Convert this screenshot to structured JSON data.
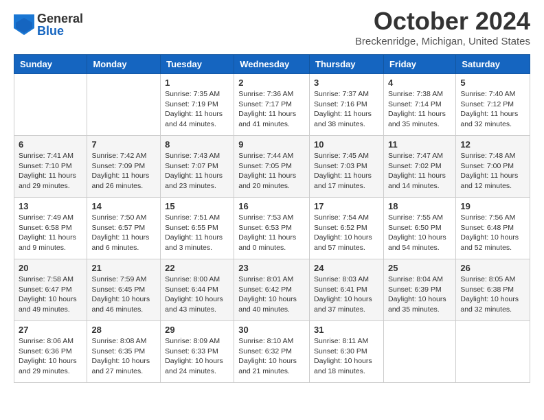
{
  "header": {
    "logo_general": "General",
    "logo_blue": "Blue",
    "title": "October 2024",
    "subtitle": "Breckenridge, Michigan, United States"
  },
  "days_of_week": [
    "Sunday",
    "Monday",
    "Tuesday",
    "Wednesday",
    "Thursday",
    "Friday",
    "Saturday"
  ],
  "weeks": [
    [
      {
        "day": null,
        "info": null
      },
      {
        "day": null,
        "info": null
      },
      {
        "day": "1",
        "info": "Sunrise: 7:35 AM\nSunset: 7:19 PM\nDaylight: 11 hours and 44 minutes."
      },
      {
        "day": "2",
        "info": "Sunrise: 7:36 AM\nSunset: 7:17 PM\nDaylight: 11 hours and 41 minutes."
      },
      {
        "day": "3",
        "info": "Sunrise: 7:37 AM\nSunset: 7:16 PM\nDaylight: 11 hours and 38 minutes."
      },
      {
        "day": "4",
        "info": "Sunrise: 7:38 AM\nSunset: 7:14 PM\nDaylight: 11 hours and 35 minutes."
      },
      {
        "day": "5",
        "info": "Sunrise: 7:40 AM\nSunset: 7:12 PM\nDaylight: 11 hours and 32 minutes."
      }
    ],
    [
      {
        "day": "6",
        "info": "Sunrise: 7:41 AM\nSunset: 7:10 PM\nDaylight: 11 hours and 29 minutes."
      },
      {
        "day": "7",
        "info": "Sunrise: 7:42 AM\nSunset: 7:09 PM\nDaylight: 11 hours and 26 minutes."
      },
      {
        "day": "8",
        "info": "Sunrise: 7:43 AM\nSunset: 7:07 PM\nDaylight: 11 hours and 23 minutes."
      },
      {
        "day": "9",
        "info": "Sunrise: 7:44 AM\nSunset: 7:05 PM\nDaylight: 11 hours and 20 minutes."
      },
      {
        "day": "10",
        "info": "Sunrise: 7:45 AM\nSunset: 7:03 PM\nDaylight: 11 hours and 17 minutes."
      },
      {
        "day": "11",
        "info": "Sunrise: 7:47 AM\nSunset: 7:02 PM\nDaylight: 11 hours and 14 minutes."
      },
      {
        "day": "12",
        "info": "Sunrise: 7:48 AM\nSunset: 7:00 PM\nDaylight: 11 hours and 12 minutes."
      }
    ],
    [
      {
        "day": "13",
        "info": "Sunrise: 7:49 AM\nSunset: 6:58 PM\nDaylight: 11 hours and 9 minutes."
      },
      {
        "day": "14",
        "info": "Sunrise: 7:50 AM\nSunset: 6:57 PM\nDaylight: 11 hours and 6 minutes."
      },
      {
        "day": "15",
        "info": "Sunrise: 7:51 AM\nSunset: 6:55 PM\nDaylight: 11 hours and 3 minutes."
      },
      {
        "day": "16",
        "info": "Sunrise: 7:53 AM\nSunset: 6:53 PM\nDaylight: 11 hours and 0 minutes."
      },
      {
        "day": "17",
        "info": "Sunrise: 7:54 AM\nSunset: 6:52 PM\nDaylight: 10 hours and 57 minutes."
      },
      {
        "day": "18",
        "info": "Sunrise: 7:55 AM\nSunset: 6:50 PM\nDaylight: 10 hours and 54 minutes."
      },
      {
        "day": "19",
        "info": "Sunrise: 7:56 AM\nSunset: 6:48 PM\nDaylight: 10 hours and 52 minutes."
      }
    ],
    [
      {
        "day": "20",
        "info": "Sunrise: 7:58 AM\nSunset: 6:47 PM\nDaylight: 10 hours and 49 minutes."
      },
      {
        "day": "21",
        "info": "Sunrise: 7:59 AM\nSunset: 6:45 PM\nDaylight: 10 hours and 46 minutes."
      },
      {
        "day": "22",
        "info": "Sunrise: 8:00 AM\nSunset: 6:44 PM\nDaylight: 10 hours and 43 minutes."
      },
      {
        "day": "23",
        "info": "Sunrise: 8:01 AM\nSunset: 6:42 PM\nDaylight: 10 hours and 40 minutes."
      },
      {
        "day": "24",
        "info": "Sunrise: 8:03 AM\nSunset: 6:41 PM\nDaylight: 10 hours and 37 minutes."
      },
      {
        "day": "25",
        "info": "Sunrise: 8:04 AM\nSunset: 6:39 PM\nDaylight: 10 hours and 35 minutes."
      },
      {
        "day": "26",
        "info": "Sunrise: 8:05 AM\nSunset: 6:38 PM\nDaylight: 10 hours and 32 minutes."
      }
    ],
    [
      {
        "day": "27",
        "info": "Sunrise: 8:06 AM\nSunset: 6:36 PM\nDaylight: 10 hours and 29 minutes."
      },
      {
        "day": "28",
        "info": "Sunrise: 8:08 AM\nSunset: 6:35 PM\nDaylight: 10 hours and 27 minutes."
      },
      {
        "day": "29",
        "info": "Sunrise: 8:09 AM\nSunset: 6:33 PM\nDaylight: 10 hours and 24 minutes."
      },
      {
        "day": "30",
        "info": "Sunrise: 8:10 AM\nSunset: 6:32 PM\nDaylight: 10 hours and 21 minutes."
      },
      {
        "day": "31",
        "info": "Sunrise: 8:11 AM\nSunset: 6:30 PM\nDaylight: 10 hours and 18 minutes."
      },
      {
        "day": null,
        "info": null
      },
      {
        "day": null,
        "info": null
      }
    ]
  ]
}
